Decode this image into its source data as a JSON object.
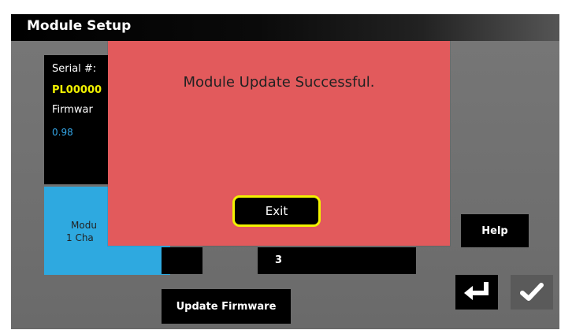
{
  "header": {
    "title": "Module Setup"
  },
  "info": {
    "serial_label": "Serial #:",
    "serial_value": "PL00000",
    "firmware_label": "Firmwar",
    "firmware_value": "0.98"
  },
  "module_card": {
    "line1": "Modu",
    "line2": "1 Cha"
  },
  "channel_field": {
    "value": "3"
  },
  "buttons": {
    "help": "Help",
    "update_firmware": "Update Firmware"
  },
  "dialog": {
    "message": "Module Update Successful.",
    "exit_label": "Exit"
  },
  "colors": {
    "dialog_bg": "#e25a5c",
    "highlight": "#f2f200",
    "module_card": "#2ea9e0",
    "serial_text": "#f0f000",
    "firmware_text": "#34a7e8"
  },
  "icons": {
    "back": "return-arrow-icon",
    "confirm": "checkmark-icon"
  }
}
